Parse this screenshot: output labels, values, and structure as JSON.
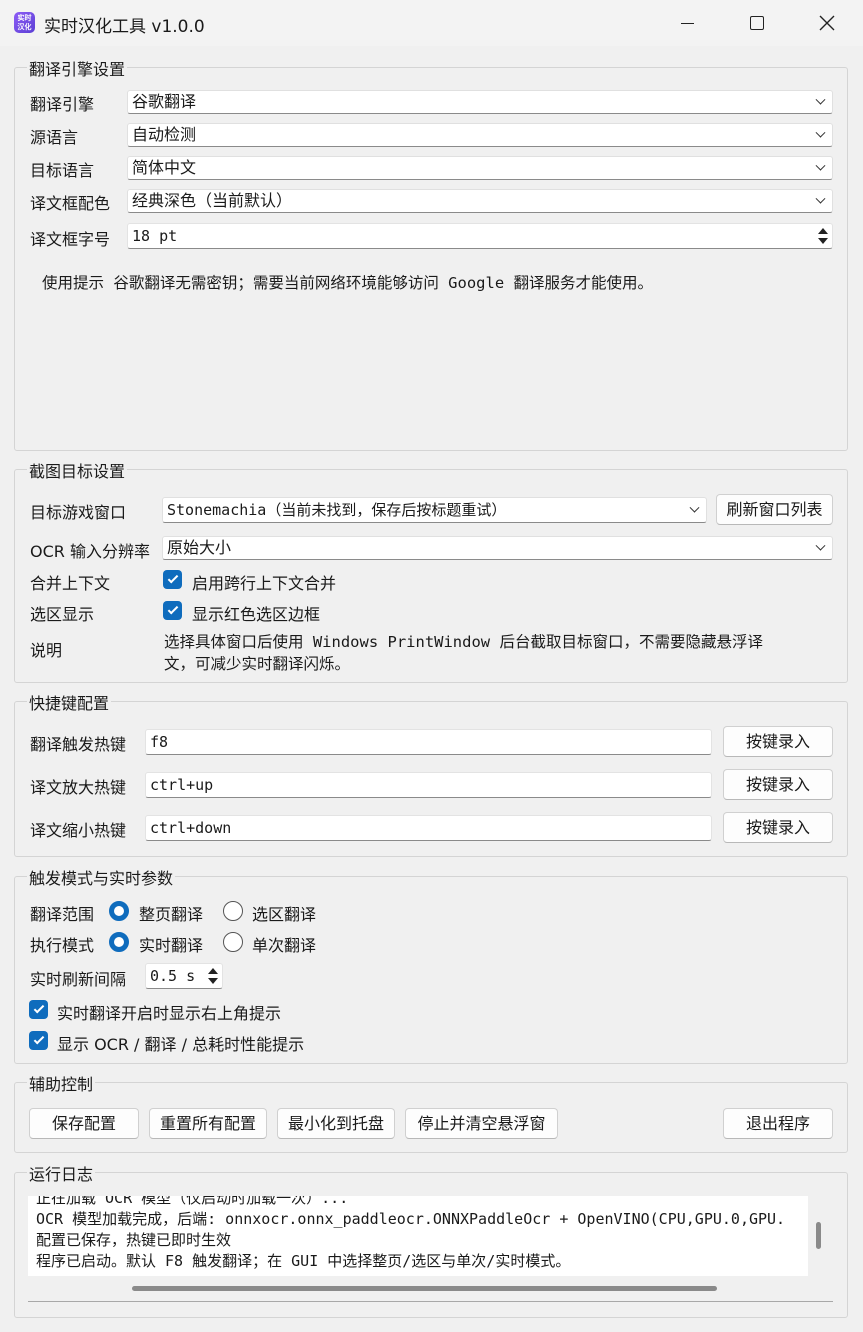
{
  "window": {
    "icon_text": "实时\n汉化",
    "title": "实时汉化工具 v1.0.0"
  },
  "engine_group": {
    "title": "翻译引擎设置",
    "engine_label": "翻译引擎",
    "engine_value": "谷歌翻译",
    "source_label": "源语言",
    "source_value": "自动检测",
    "target_label": "目标语言",
    "target_value": "简体中文",
    "color_label": "译文框配色",
    "color_value": "经典深色（当前默认）",
    "fontsize_label": "译文框字号",
    "fontsize_value": "18 pt",
    "hint": "使用提示 谷歌翻译无需密钥；需要当前网络环境能够访问 Google 翻译服务才能使用。"
  },
  "capture_group": {
    "title": "截图目标设置",
    "window_label": "目标游戏窗口",
    "window_value": "Stonemachia（当前未找到，保存后按标题重试）",
    "refresh_button": "刷新窗口列表",
    "ocr_label": "OCR 输入分辨率",
    "ocr_value": "原始大小",
    "merge_label": "合并上下文",
    "merge_check": "启用跨行上下文合并",
    "merge_checked": true,
    "region_label": "选区显示",
    "region_check": "显示红色选区边框",
    "region_checked": true,
    "note_label": "说明",
    "note_line1": "选择具体窗口后使用 Windows PrintWindow 后台截取目标窗口，不需要隐藏悬浮译",
    "note_line2": "文，可减少实时翻译闪烁。"
  },
  "hotkey_group": {
    "title": "快捷键配置",
    "trigger_label": "翻译触发热键",
    "trigger_value": "f8",
    "zoom_in_label": "译文放大热键",
    "zoom_in_value": "ctrl+up",
    "zoom_out_label": "译文缩小热键",
    "zoom_out_value": "ctrl+down",
    "record_button": "按键录入"
  },
  "mode_group": {
    "title": "触发模式与实时参数",
    "range_label": "翻译范围",
    "range_full": "整页翻译",
    "range_region": "选区翻译",
    "range_selected": "整页翻译",
    "exec_label": "执行模式",
    "exec_realtime": "实时翻译",
    "exec_single": "单次翻译",
    "exec_selected": "实时翻译",
    "interval_label": "实时刷新间隔",
    "interval_value": "0.5 s",
    "corner_hint_check": "实时翻译开启时显示右上角提示",
    "perf_hint_check": "显示 OCR / 翻译 / 总耗时性能提示"
  },
  "aux_group": {
    "title": "辅助控制",
    "save": "保存配置",
    "reset": "重置所有配置",
    "minimize": "最小化到托盘",
    "stop_clear": "停止并清空悬浮窗",
    "exit": "退出程序"
  },
  "log_group": {
    "title": "运行日志",
    "lines": [
      "正在加载 OCR 模型（仅启动时加载一次）...",
      "OCR 模型加载完成，后端: onnxocr.onnx_paddleocr.ONNXPaddleOcr + OpenVINO(CPU,GPU.0,GPU.",
      "配置已保存，热键已即时生效",
      "程序已启动。默认 F8 触发翻译；在 GUI 中选择整页/选区与单次/实时模式。"
    ]
  }
}
